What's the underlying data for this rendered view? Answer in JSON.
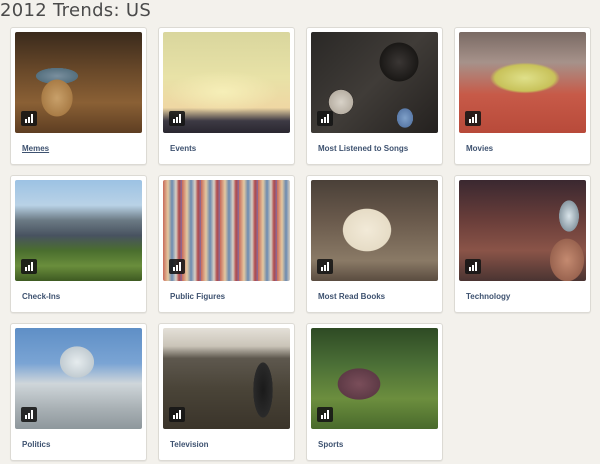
{
  "page": {
    "title": "2012 Trends: US"
  },
  "cards": [
    {
      "label": "Memes",
      "thumb": "memes",
      "active": true
    },
    {
      "label": "Events",
      "thumb": "events",
      "active": false
    },
    {
      "label": "Most Listened to Songs",
      "thumb": "songs",
      "active": false
    },
    {
      "label": "Movies",
      "thumb": "movies",
      "active": false
    },
    {
      "label": "Check-Ins",
      "thumb": "checkins",
      "active": false
    },
    {
      "label": "Public Figures",
      "thumb": "figures",
      "active": false
    },
    {
      "label": "Most Read Books",
      "thumb": "books",
      "active": false
    },
    {
      "label": "Technology",
      "thumb": "tech",
      "active": false
    },
    {
      "label": "Politics",
      "thumb": "politics",
      "active": false
    },
    {
      "label": "Television",
      "thumb": "tv",
      "active": false
    },
    {
      "label": "Sports",
      "thumb": "sports",
      "active": false
    }
  ],
  "icons": {
    "badge": "bar-chart-icon"
  },
  "colors": {
    "background": "#f3f1ec",
    "label": "#3e5270",
    "title": "#4a4a4a"
  }
}
